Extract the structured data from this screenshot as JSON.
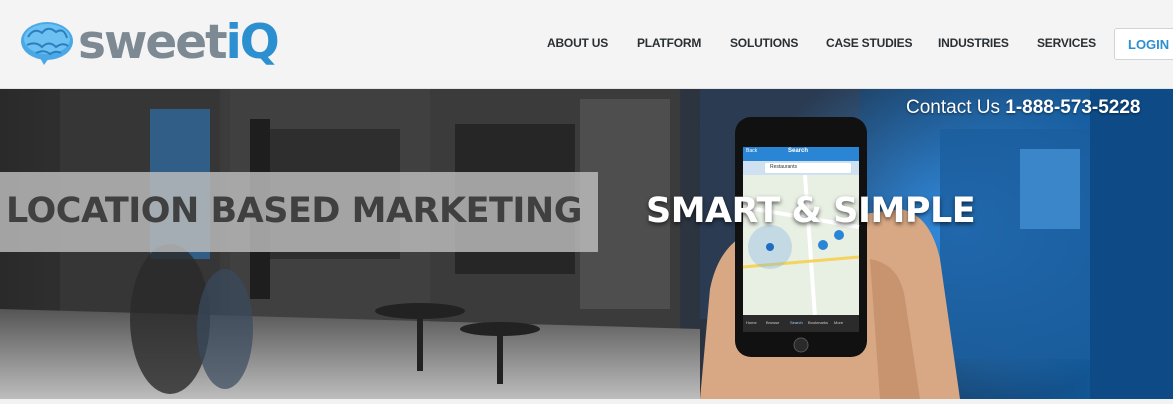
{
  "brand": {
    "name_part1": "sweet",
    "name_part2": "iQ"
  },
  "nav": {
    "items": [
      "ABOUT US",
      "PLATFORM",
      "SOLUTIONS",
      "CASE STUDIES",
      "INDUSTRIES",
      "SERVICES"
    ],
    "login_label": "LOGIN"
  },
  "hero": {
    "contact_label": "Contact Us",
    "contact_phone": "1-888-573-5228",
    "headline": "LOCATION BASED MARKETING",
    "tagline": "SMART & SIMPLE"
  },
  "phone_screen": {
    "title": "Search",
    "back_label": "Back",
    "search_value": "Restaurants",
    "tabs": [
      "Home",
      "Browse",
      "Search",
      "Bookmarks",
      "More"
    ]
  },
  "colors": {
    "brand_blue": "#2b8fd0",
    "brand_gray": "#7d8a93",
    "nav_text": "#2a2f33"
  }
}
